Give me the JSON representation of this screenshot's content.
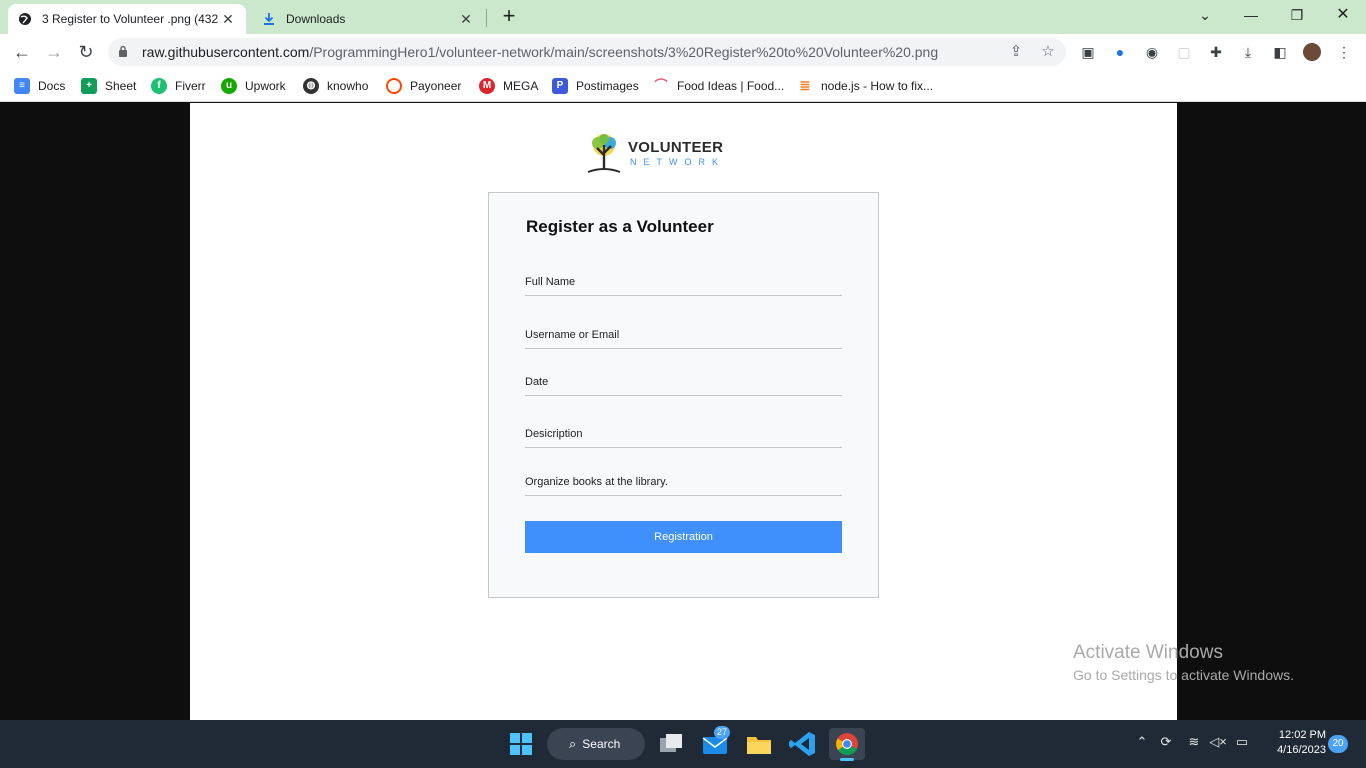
{
  "browser": {
    "tabs": [
      {
        "title": "3 Register to Volunteer .png (432",
        "active": true
      },
      {
        "title": "Downloads",
        "active": false
      }
    ],
    "url_host": "raw.githubusercontent.com",
    "url_path": "/ProgrammingHero1/volunteer-network/main/screenshots/3%20Register%20to%20Volunteer%20.png",
    "bookmarks": [
      {
        "label": "Docs",
        "color": "#4285f4"
      },
      {
        "label": "Sheet",
        "color": "#0f9d58"
      },
      {
        "label": "Fiverr",
        "color": "#1dbf73"
      },
      {
        "label": "Upwork",
        "color": "#14a800"
      },
      {
        "label": "knowho",
        "color": "#333333"
      },
      {
        "label": "Payoneer",
        "color": "#ff4800"
      },
      {
        "label": "MEGA",
        "color": "#d9272e"
      },
      {
        "label": "Postimages",
        "color": "#3b5bdb"
      },
      {
        "label": "Food Ideas | Food...",
        "color": "#e85d75"
      },
      {
        "label": "node.js - How to fix...",
        "color": "#f48024"
      }
    ]
  },
  "page": {
    "logo_line1": "VOLUNTEER",
    "logo_line2": "NETWORK",
    "form_title": "Register as a Volunteer",
    "fields": {
      "full_name": "Full Name",
      "username": "Username or Email",
      "date": "Date",
      "description": "Desicription",
      "task": "Organize books at the library."
    },
    "submit_label": "Registration",
    "accent": "#3f90fc"
  },
  "watermark": {
    "line1": "Activate Windows",
    "line2": "Go to Settings to activate Windows."
  },
  "taskbar": {
    "search_label": "Search",
    "mail_badge": "27",
    "time": "12:02 PM",
    "date": "4/16/2023",
    "notifications": "20"
  }
}
